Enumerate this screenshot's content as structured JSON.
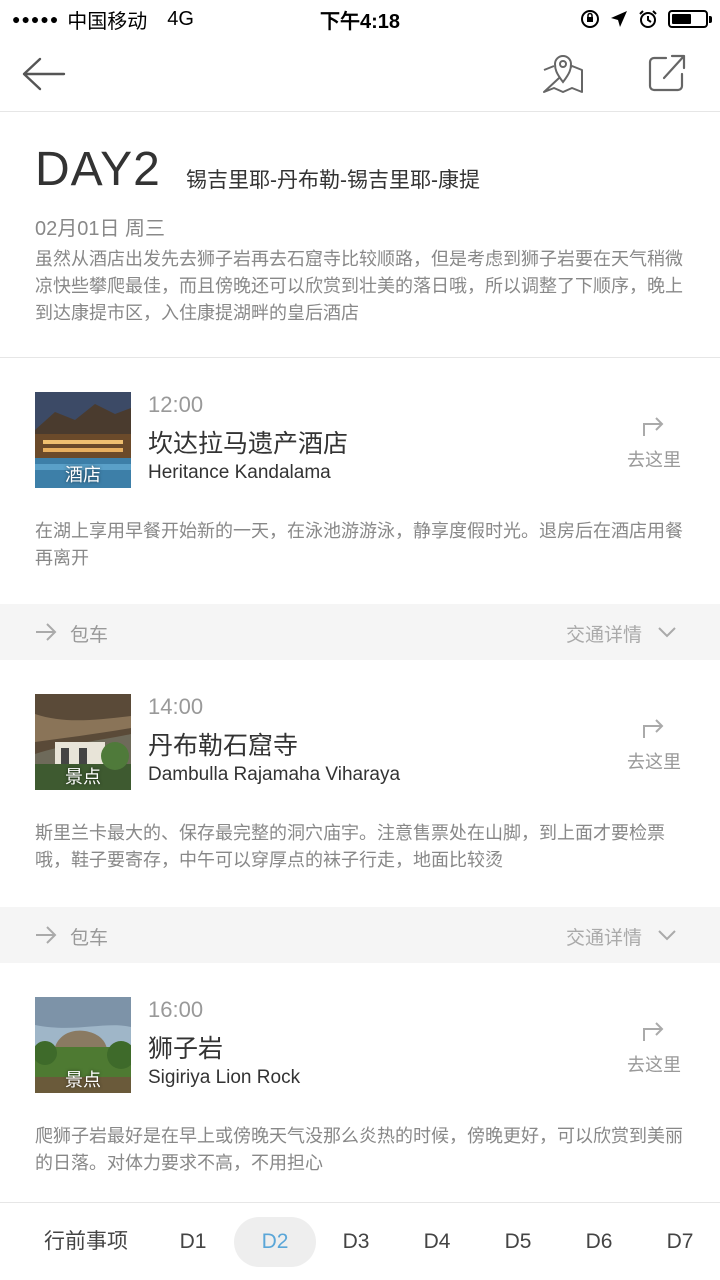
{
  "status_bar": {
    "signal_dots": "●●●●●",
    "carrier": "中国移动",
    "network": "4G",
    "time": "下午4:18",
    "battery_level": 0.6
  },
  "nav": {
    "back_icon": "back-arrow-icon",
    "map_icon": "map-pin-icon",
    "share_icon": "share-icon"
  },
  "day": {
    "title": "DAY2",
    "route": "锡吉里耶-丹布勒-锡吉里耶-康提",
    "date": "02月01日 周三",
    "description": "虽然从酒店出发先去狮子岩再去石窟寺比较顺路，但是考虑到狮子岩要在天气稍微凉快些攀爬最佳，而且傍晚还可以欣赏到壮美的落日哦，所以调整了下顺序，晚上到达康提市区，入住康提湖畔的皇后酒店"
  },
  "stops": [
    {
      "time": "12:00",
      "name": "坎达拉马遗产酒店",
      "name_en": "Heritance Kandalama",
      "tag": "酒店",
      "go_label": "去这里",
      "description": "在湖上享用早餐开始新的一天，在泳池游游泳，静享度假时光。退房后在酒店用餐再离开"
    },
    {
      "time": "14:00",
      "name": "丹布勒石窟寺",
      "name_en": "Dambulla Rajamaha Viharaya",
      "tag": "景点",
      "go_label": "去这里",
      "description": "斯里兰卡最大的、保存最完整的洞穴庙宇。注意售票处在山脚，到上面才要检票哦，鞋子要寄存，中午可以穿厚点的袜子行走，地面比较烫"
    },
    {
      "time": "16:00",
      "name": "狮子岩",
      "name_en": "Sigiriya Lion Rock",
      "tag": "景点",
      "go_label": "去这里",
      "description": "爬狮子岩最好是在早上或傍晚天气没那么炎热的时候，傍晚更好，可以欣赏到美丽的日落。对体力要求不高，不用担心"
    }
  ],
  "transports": [
    {
      "mode": "包车",
      "detail": "交通详情"
    },
    {
      "mode": "包车",
      "detail": "交通详情"
    }
  ],
  "tabs": [
    "行前事项",
    "D1",
    "D2",
    "D3",
    "D4",
    "D5",
    "D6",
    "D7"
  ],
  "active_tab": "D2",
  "colors": {
    "accent": "#5aa6d8",
    "muted_text": "#888888",
    "section_bg": "#f5f5f5"
  }
}
